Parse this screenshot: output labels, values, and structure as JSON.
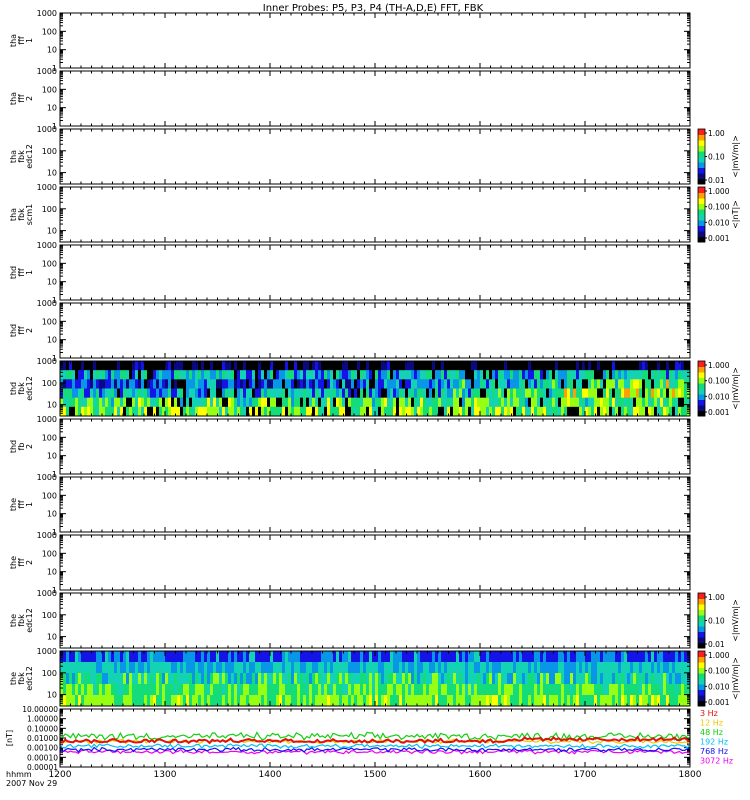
{
  "chart_data": {
    "type": "heatmap",
    "title": "Inner Probes: P5, P3, P4 (TH-A,D,E) FFT, FBK",
    "x_axis": {
      "ticks": [
        "1200",
        "1300",
        "1400",
        "1500",
        "1600",
        "1700",
        "1800"
      ],
      "xlim": [
        1200,
        1800
      ],
      "corner_label": "hhmm",
      "date_label": "2007 Nov 29"
    },
    "panels": [
      {
        "ylabel": [
          "tha",
          "fff",
          "1"
        ],
        "yticks": [
          "1000",
          "100",
          "10",
          "1"
        ],
        "ylim": [
          1,
          1000
        ],
        "log": true,
        "data": "none"
      },
      {
        "ylabel": [
          "tha",
          "fff",
          "2"
        ],
        "yticks": [
          "1000",
          "100",
          "10",
          "1"
        ],
        "ylim": [
          1,
          1000
        ],
        "log": true,
        "data": "none"
      },
      {
        "ylabel": [
          "tha",
          "fbk",
          "edc12"
        ],
        "yticks": [
          "1000",
          "100",
          "10"
        ],
        "ylim": [
          3,
          1000
        ],
        "log": true,
        "data": "none",
        "colorbar": {
          "ticks": [
            "1.00",
            "0.10",
            "0.01"
          ],
          "label": "<|mV/m|>"
        }
      },
      {
        "ylabel": [
          "tha",
          "fbk",
          "scm1"
        ],
        "yticks": [
          "1000",
          "100",
          "10"
        ],
        "ylim": [
          3,
          1000
        ],
        "log": true,
        "data": "none",
        "colorbar": {
          "ticks": [
            "1.000",
            "0.100",
            "0.010",
            "0.001"
          ],
          "label": "<|nT|>"
        }
      },
      {
        "ylabel": [
          "thd",
          "fff",
          "1"
        ],
        "yticks": [
          "1000",
          "100",
          "10",
          "1"
        ],
        "ylim": [
          1,
          1000
        ],
        "log": true,
        "data": "none"
      },
      {
        "ylabel": [
          "thd",
          "fff",
          "2"
        ],
        "yticks": [
          "1000",
          "100",
          "10",
          "1"
        ],
        "ylim": [
          1,
          1000
        ],
        "log": true,
        "data": "none"
      },
      {
        "ylabel": [
          "thd",
          "fbk",
          "edc12"
        ],
        "yticks": [
          "1000",
          "100",
          "10"
        ],
        "ylim": [
          3,
          1000
        ],
        "log": true,
        "data": "spectrogram",
        "colorbar": {
          "ticks": [
            "1.000",
            "0.100",
            "0.010",
            "0.001"
          ],
          "label": "<|mV/m|>"
        }
      },
      {
        "ylabel": [
          "thd",
          "fb",
          "2"
        ],
        "yticks": [
          "1000",
          "100",
          "10",
          "1"
        ],
        "ylim": [
          1,
          1000
        ],
        "log": true,
        "data": "none"
      },
      {
        "ylabel": [
          "the",
          "fff",
          "1"
        ],
        "yticks": [
          "1000",
          "100",
          "10",
          "1"
        ],
        "ylim": [
          1,
          1000
        ],
        "log": true,
        "data": "none"
      },
      {
        "ylabel": [
          "the",
          "fff",
          "2"
        ],
        "yticks": [
          "1000",
          "100",
          "10",
          "1"
        ],
        "ylim": [
          1,
          1000
        ],
        "log": true,
        "data": "none"
      },
      {
        "ylabel": [
          "the",
          "fbk",
          "edc12"
        ],
        "yticks": [
          "1000",
          "100",
          "10"
        ],
        "ylim": [
          3,
          1000
        ],
        "log": true,
        "data": "none",
        "colorbar": {
          "ticks": [
            "1.00",
            "0.10",
            "0.01"
          ],
          "label": "<|mV/m|>"
        }
      },
      {
        "ylabel": [
          "the",
          "fbk",
          "edc12"
        ],
        "yticks": [
          "1000",
          "100",
          "10"
        ],
        "ylim": [
          3,
          1000
        ],
        "log": true,
        "data": "spectrogram",
        "colorbar": {
          "ticks": [
            "1.000",
            "0.100",
            "0.010",
            "0.001"
          ],
          "label": "<|mV/m|>"
        }
      }
    ],
    "line_panel": {
      "ylabel": "[nT]",
      "yticks": [
        "10.00000",
        "1.00000",
        "0.10000",
        "0.01000",
        "0.00100",
        "0.00010",
        "0.00001"
      ],
      "ylim": [
        1e-05,
        10
      ],
      "log": true,
      "series": [
        {
          "name": "3 Hz",
          "color": "#e01010",
          "level": 0.004
        },
        {
          "name": "12 Hz",
          "color": "#f0c800",
          "level": 0.0035
        },
        {
          "name": "48 Hz",
          "color": "#10d010",
          "level": 0.008
        },
        {
          "name": "192 Hz",
          "color": "#00c0f0",
          "level": 0.0012
        },
        {
          "name": "768 Hz",
          "color": "#1010f0",
          "level": 0.0005
        },
        {
          "name": "3072 Hz",
          "color": "#f000f0",
          "level": 0.0003
        }
      ]
    },
    "colormap": [
      "#000000",
      "#0a0a80",
      "#1414e6",
      "#0a96e6",
      "#14d2b4",
      "#14dc78",
      "#96ff14",
      "#ffff00",
      "#ffa000",
      "#ff1e1e"
    ]
  }
}
